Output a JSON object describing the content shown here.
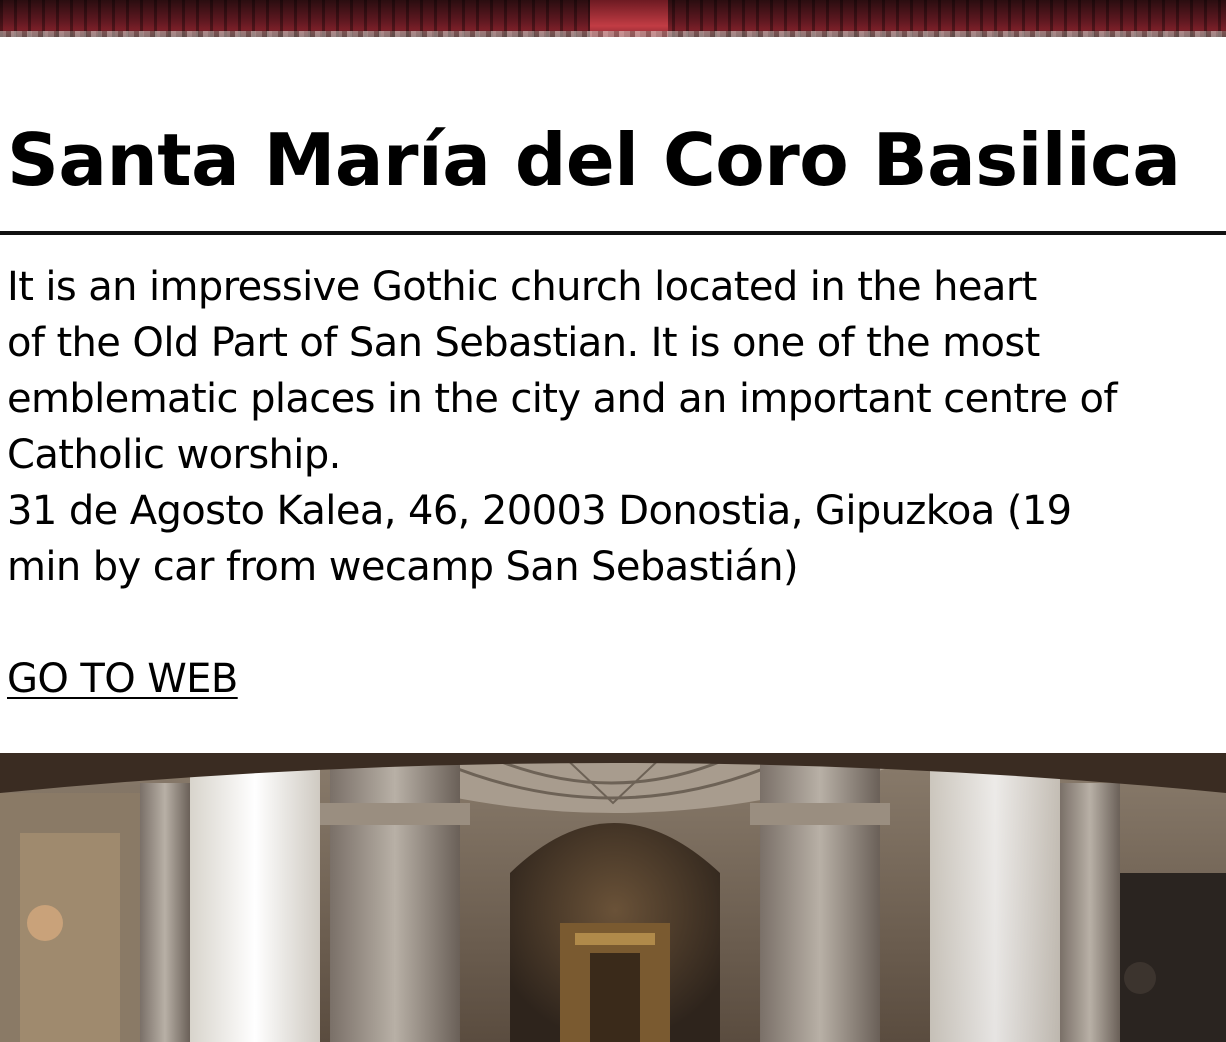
{
  "top_image": {
    "alt": "theatre seats"
  },
  "title": "Santa María del Coro Basilica",
  "description": {
    "lines": [
      " It is an impressive Gothic church located in the heart",
      "of the Old Part of San Sebastian. It is one of the most",
      "emblematic places in the city and an important centre of",
      "Catholic worship.",
      "31 de Agosto Kalea, 46, 20003 Donostia, Gipuzkoa   (19",
      "min by car from wecamp San Sebastián)"
    ]
  },
  "link": {
    "label": "GO TO WEB"
  },
  "church_image": {
    "alt": "Santa María del Coro Basilica interior"
  }
}
